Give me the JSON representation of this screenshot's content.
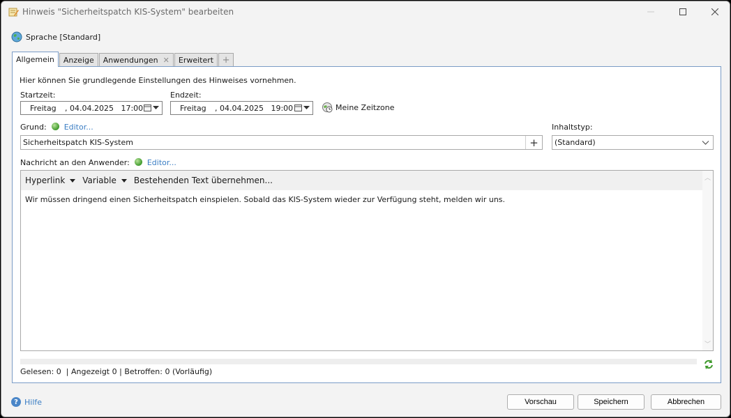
{
  "window": {
    "title": "Hinweis \"Sicherheitspatch KIS-System\" bearbeiten"
  },
  "language": {
    "label": "Sprache [Standard]"
  },
  "tabs": [
    {
      "label": "Allgemein",
      "active": true
    },
    {
      "label": "Anzeige"
    },
    {
      "label": "Anwendungen",
      "closable": true
    },
    {
      "label": "Erweitert"
    },
    {
      "label": "+"
    }
  ],
  "general": {
    "intro": "Hier können Sie grundlegende Einstellungen des Hinweises vornehmen.",
    "start": {
      "label": "Startzeit:",
      "day": "Freitag",
      "datetime": ", 04.04.2025   17:00"
    },
    "end": {
      "label": "Endzeit:",
      "day": "Freitag",
      "datetime": ", 04.04.2025   19:00"
    },
    "timezone": "Meine Zeitzone",
    "reason": {
      "label": "Grund:",
      "editor_link": "Editor...",
      "value": "Sicherheitspatch KIS-System"
    },
    "content_type": {
      "label": "Inhaltstyp:",
      "value": "(Standard)"
    },
    "message": {
      "label": "Nachricht an den Anwender:",
      "editor_link": "Editor...",
      "toolbar": {
        "hyperlink": "Hyperlink",
        "variable": "Variable",
        "apply_text": "Bestehenden Text übernehmen..."
      },
      "text": "Wir müssen dringend einen Sicherheitspatch einspielen. Sobald das KIS-System wieder zur Verfügung steht, melden wir uns."
    },
    "stats": "Gelesen: 0  | Angezeigt 0 | Betroffen: 0 (Vorläufig)"
  },
  "footer": {
    "help": "Hilfe",
    "preview": "Vorschau",
    "save": "Speichern",
    "cancel": "Abbrechen"
  },
  "colors": {
    "accent_border": "#7a9cc6",
    "link": "#3b7ec4",
    "background": "#f3f3f3"
  },
  "icons": {
    "title": "note-edit-icon",
    "language": "globe-icon",
    "timezone": "clock-globe-icon",
    "editor": "green-dot-icon",
    "refresh": "refresh-icon",
    "help": "help-icon"
  }
}
